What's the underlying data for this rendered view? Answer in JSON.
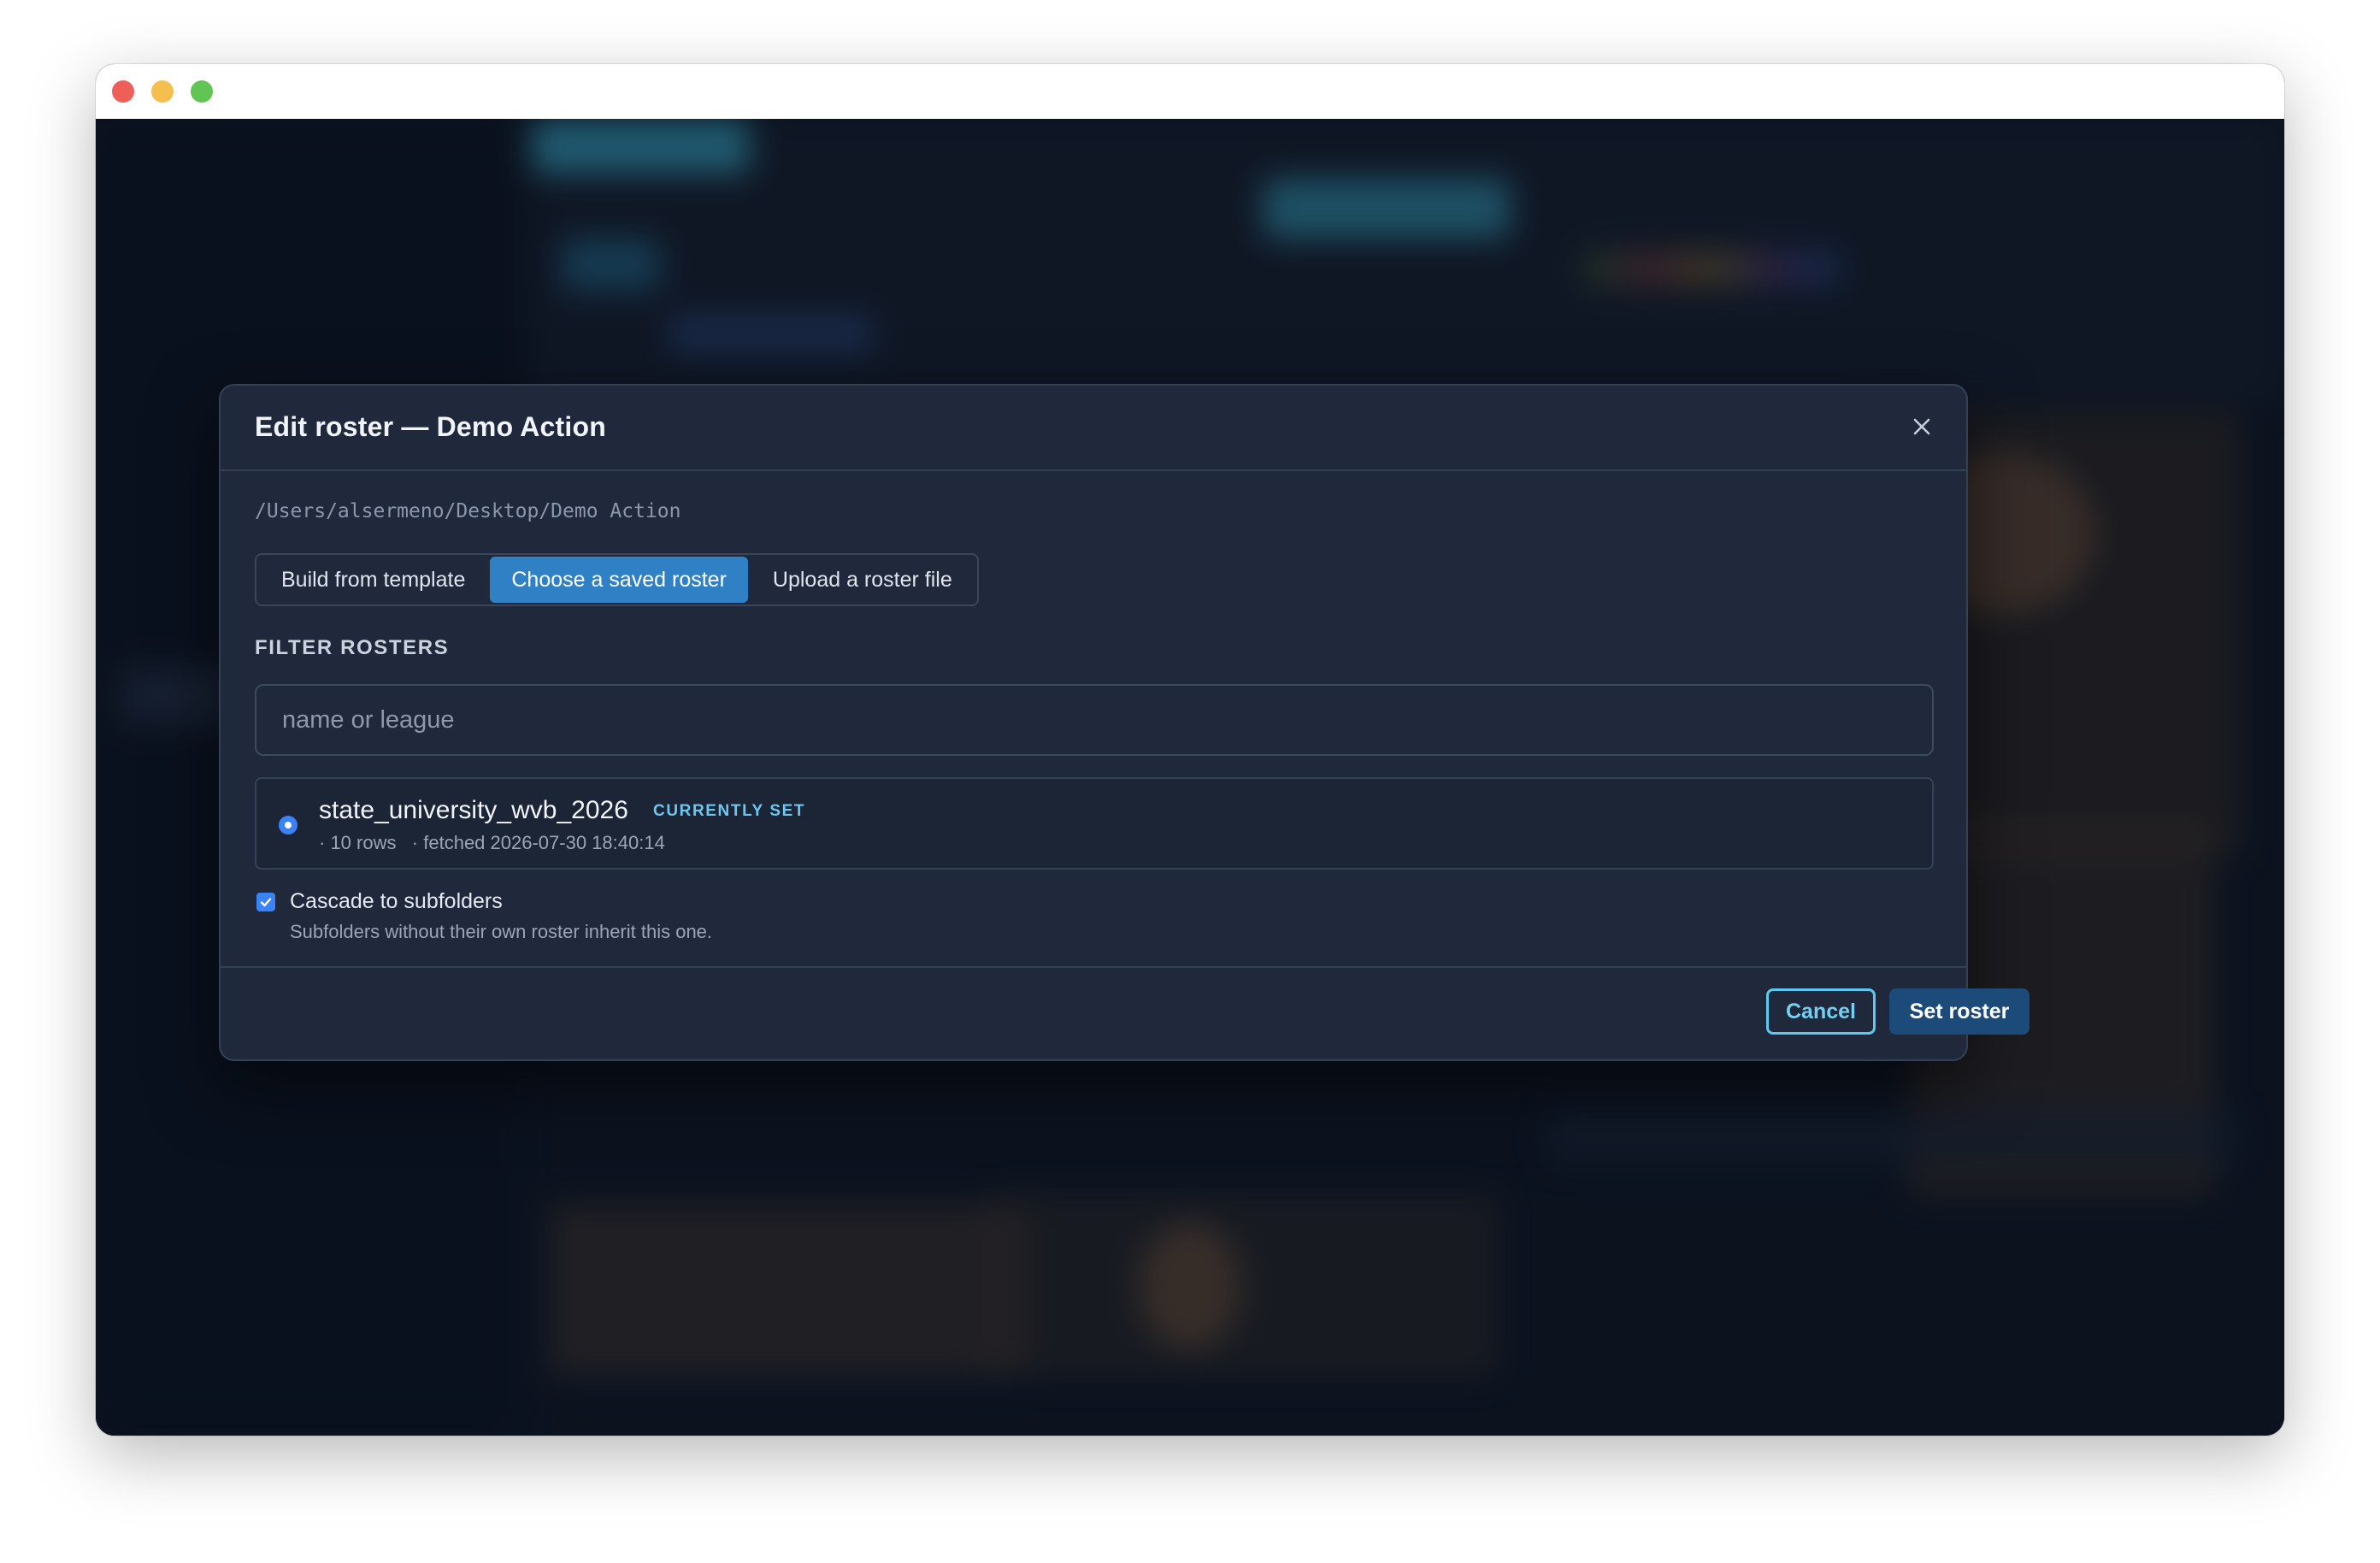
{
  "modal": {
    "title": "Edit roster — Demo Action",
    "path": "/Users/alsermeno/Desktop/Demo Action",
    "source_tabs": [
      {
        "label": "Build from template",
        "active": false
      },
      {
        "label": "Choose a saved roster",
        "active": true
      },
      {
        "label": "Upload a roster file",
        "active": false
      }
    ],
    "filter": {
      "label": "FILTER ROSTERS",
      "placeholder": "name or league",
      "value": ""
    },
    "rosters": [
      {
        "name": "state_university_wvb_2026",
        "badge": "CURRENTLY SET",
        "meta": "· 10 rows   · fetched 2026-07-30 18:40:14",
        "selected": true
      }
    ],
    "cascade": {
      "label": "Cascade to subfolders",
      "help": "Subfolders without their own roster inherit this one.",
      "checked": true
    },
    "buttons": {
      "cancel": "Cancel",
      "submit": "Set roster"
    }
  },
  "icons": {
    "close": "close-icon",
    "radio": "radio-selected-icon",
    "checkbox": "checkmark-icon"
  },
  "colors": {
    "accent": "#2f80c4",
    "badge": "#6cc6f0",
    "modal_bg": "#1f293b",
    "primary_button": "#1c4b7a"
  }
}
